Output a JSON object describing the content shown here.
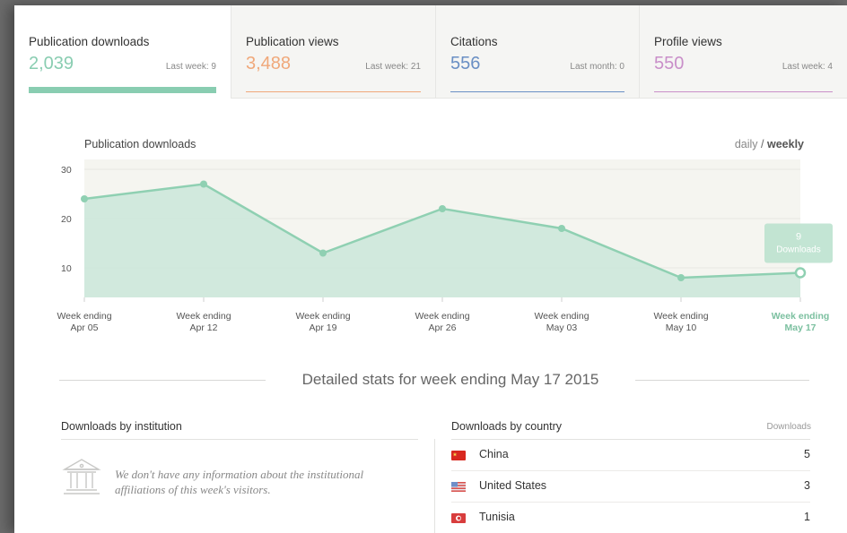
{
  "tabs": [
    {
      "title": "Publication downloads",
      "value": "2,039",
      "last": "Last week: 9",
      "color": "#89cdb1",
      "active": true
    },
    {
      "title": "Publication views",
      "value": "3,488",
      "last": "Last week: 21",
      "color": "#f0a87a",
      "active": false
    },
    {
      "title": "Citations",
      "value": "556",
      "last": "Last month: 0",
      "color": "#6a8fc4",
      "active": false
    },
    {
      "title": "Profile views",
      "value": "550",
      "last": "Last week: 4",
      "color": "#c98fc9",
      "active": false
    }
  ],
  "chart": {
    "title": "Publication downloads",
    "toggle": {
      "daily": "daily",
      "separator": "/",
      "weekly": "weekly",
      "selected": "weekly"
    }
  },
  "chart_data": {
    "type": "area",
    "title": "Publication downloads",
    "categories": [
      "Week ending Apr 05",
      "Week ending Apr 12",
      "Week ending Apr 19",
      "Week ending Apr 26",
      "Week ending May 03",
      "Week ending May 10",
      "Week ending May 17"
    ],
    "category_lines": [
      [
        "Week ending",
        "Apr 05"
      ],
      [
        "Week ending",
        "Apr 12"
      ],
      [
        "Week ending",
        "Apr 19"
      ],
      [
        "Week ending",
        "Apr 26"
      ],
      [
        "Week ending",
        "May 03"
      ],
      [
        "Week ending",
        "May 10"
      ],
      [
        "Week ending",
        "May 17"
      ]
    ],
    "values": [
      24,
      27,
      13,
      22,
      18,
      8,
      9
    ],
    "yticks": [
      10,
      20,
      30
    ],
    "ylim": [
      4,
      32
    ],
    "highlight_index": 6,
    "tooltip": {
      "value": "9",
      "label": "Downloads"
    },
    "colors": {
      "line": "#8fd0b2",
      "fill": "#cde8da",
      "plot_bg": "#f5f5f0",
      "highlight_text": "#7cc0a0",
      "tooltip_bg": "#b8e0cc"
    }
  },
  "detail": {
    "title": "Detailed stats for week ending May 17 2015"
  },
  "institution": {
    "heading": "Downloads by institution",
    "icon": "institution-building-icon",
    "message": "We don't have any information about the institutional affiliations of this week's visitors."
  },
  "countries": {
    "heading": "Downloads by country",
    "column": "Downloads",
    "rows": [
      {
        "name": "China",
        "count": "5",
        "flag": "china-flag-icon",
        "color": "#d8281f"
      },
      {
        "name": "United States",
        "count": "3",
        "flag": "us-flag-icon",
        "color": "#6f8fc8"
      },
      {
        "name": "Tunisia",
        "count": "1",
        "flag": "tunisia-flag-icon",
        "color": "#d83d3d"
      }
    ]
  }
}
